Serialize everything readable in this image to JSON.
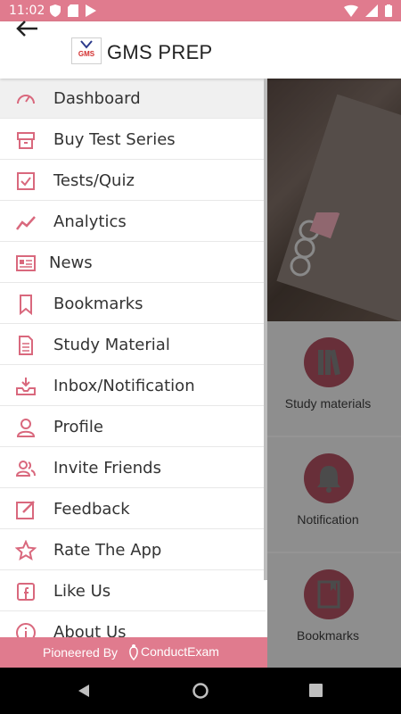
{
  "status": {
    "time": "11:02"
  },
  "app": {
    "title": "GMS PREP",
    "logo_text": "GMS"
  },
  "drawer": {
    "items": [
      {
        "label": "Dashboard"
      },
      {
        "label": "Buy Test Series"
      },
      {
        "label": "Tests/Quiz"
      },
      {
        "label": "Analytics"
      },
      {
        "label": "News"
      },
      {
        "label": "Bookmarks"
      },
      {
        "label": "Study Material"
      },
      {
        "label": "Inbox/Notification"
      },
      {
        "label": "Profile"
      },
      {
        "label": "Invite Friends"
      },
      {
        "label": "Feedback"
      },
      {
        "label": "Rate The App"
      },
      {
        "label": "Like Us"
      },
      {
        "label": "About Us"
      }
    ],
    "footer": {
      "prefix": "Pioneered By",
      "brand": "ConductExam"
    }
  },
  "tiles": [
    {
      "label": "Study materials",
      "icon": "books-icon"
    },
    {
      "label": "Notification",
      "icon": "bell-icon"
    },
    {
      "label": "Bookmarks",
      "icon": "bookmark-book-icon"
    }
  ],
  "colors": {
    "accent": "#e07b8e",
    "icon_accent": "#d9687d"
  }
}
